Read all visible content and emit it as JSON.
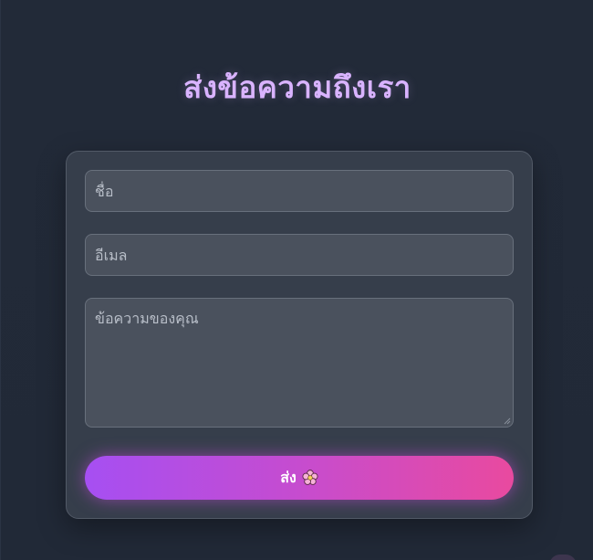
{
  "page": {
    "title": "ส่งข้อความถึงเรา"
  },
  "form": {
    "name_placeholder": "ชื่อ",
    "email_placeholder": "อีเมล",
    "message_placeholder": "ข้อความของคุณ",
    "submit_label": "ส่ง",
    "submit_icon": "flower-icon"
  },
  "colors": {
    "background": "#222a38",
    "title": "#d9b3ff",
    "card": "#363e4b",
    "input": "#4a515d",
    "button_gradient_start": "#a64ff2",
    "button_gradient_end": "#e94a9f"
  }
}
